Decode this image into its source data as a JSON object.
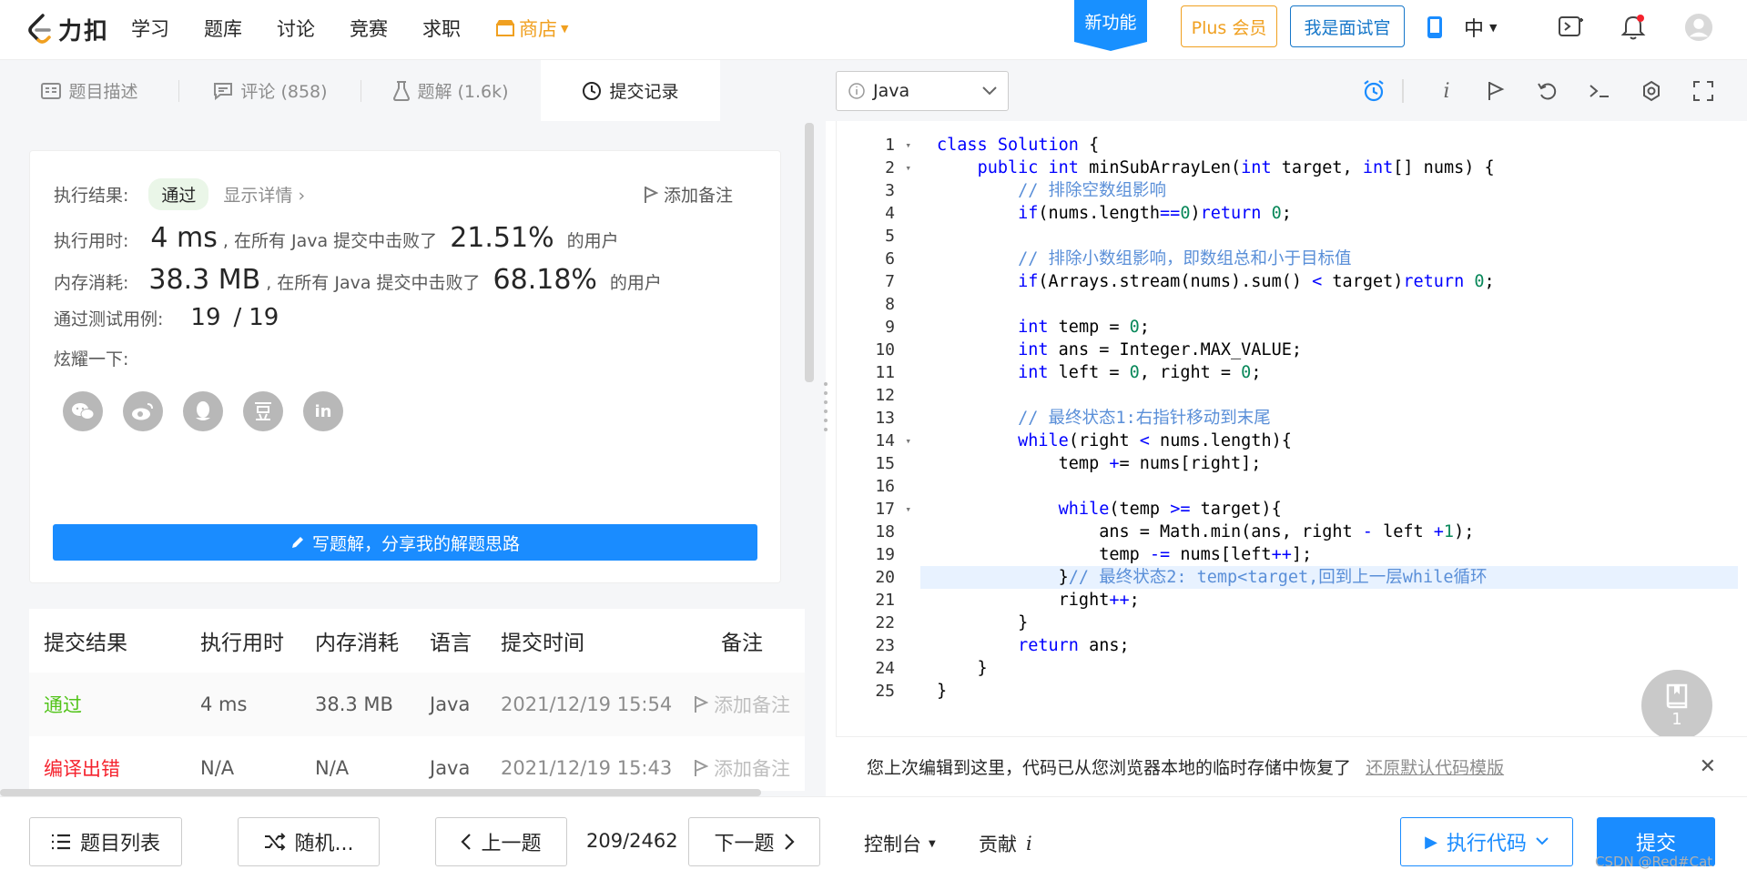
{
  "topnav": {
    "logo_text": "力扣",
    "links": [
      "学习",
      "题库",
      "讨论",
      "竞赛",
      "求职"
    ],
    "shop_label": "商店",
    "new_feature": "新功能",
    "plus_label": "Plus 会员",
    "interviewer_label": "我是面试官",
    "lang_label": "中"
  },
  "left_tabs": [
    {
      "label": "题目描述",
      "icon": "description-icon"
    },
    {
      "label": "评论 (858)",
      "icon": "comment-icon"
    },
    {
      "label": "题解 (1.6k)",
      "icon": "flask-icon"
    },
    {
      "label": "提交记录",
      "icon": "clock-icon"
    }
  ],
  "editor_toolbar": {
    "language": "Java",
    "icons": [
      "alarm-icon",
      "info-icon",
      "flag-icon",
      "reset-icon",
      "terminal-icon",
      "settings-icon",
      "fullscreen-icon"
    ]
  },
  "result": {
    "exec_result_label": "执行结果:",
    "status": "通过",
    "show_detail": "显示详情 ›",
    "add_note": "添加备注",
    "time_label": "执行用时:",
    "time_value": "4 ms",
    "time_mid": ", 在所有 Java 提交中击败了",
    "time_pct": "21.51%",
    "time_tail": "的用户",
    "mem_label": "内存消耗:",
    "mem_value": "38.3 MB",
    "mem_mid": ", 在所有 Java 提交中击败了",
    "mem_pct": "68.18%",
    "mem_tail": "的用户",
    "cases_label": "通过测试用例:",
    "cases_passed": "19",
    "cases_sep": "/",
    "cases_total": "19",
    "share_label": "炫耀一下:",
    "share_icons": [
      "wechat-icon",
      "weibo-icon",
      "qq-icon",
      "douban-icon",
      "linkedin-icon"
    ],
    "write_solution": "写题解，分享我的解题思路"
  },
  "submissions": {
    "headers": [
      "提交结果",
      "执行用时",
      "内存消耗",
      "语言",
      "提交时间",
      "备注"
    ],
    "rows": [
      {
        "status": "通过",
        "status_color": "#52c41a",
        "time": "4 ms",
        "memory": "38.3 MB",
        "lang": "Java",
        "submitted": "2021/12/19 15:54",
        "note": "添加备注"
      },
      {
        "status": "编译出错",
        "status_color": "#f5222d",
        "time": "N/A",
        "memory": "N/A",
        "lang": "Java",
        "submitted": "2021/12/19 15:43",
        "note": "添加备注"
      }
    ]
  },
  "code_lines": [
    "class Solution {",
    "    public int minSubArrayLen(int target, int[] nums) {",
    "        // 排除空数组影响",
    "        if(nums.length==0)return 0;",
    "",
    "        // 排除小数组影响，即数组总和小于目标值",
    "        if(Arrays.stream(nums).sum() < target)return 0;",
    "",
    "        int temp = 0;",
    "        int ans = Integer.MAX_VALUE;",
    "        int left = 0, right = 0;",
    "",
    "        // 最终状态1:右指针移动到末尾",
    "        while(right < nums.length){",
    "            temp += nums[right];",
    "",
    "            while(temp >= target){",
    "                ans = Math.min(ans, right - left +1);",
    "                temp -= nums[left++];",
    "            }// 最终状态2: temp<target,回到上一层while循环",
    "            right++;",
    "        }",
    "        return ans;",
    "    }",
    "}"
  ],
  "line_numbers": [
    "1",
    "2",
    "3",
    "4",
    "5",
    "6",
    "7",
    "8",
    "9",
    "10",
    "11",
    "12",
    "13",
    "14",
    "15",
    "16",
    "17",
    "18",
    "19",
    "20",
    "21",
    "22",
    "23",
    "24",
    "25"
  ],
  "float_badge": "1",
  "restore": {
    "message": "您上次编辑到这里，代码已从您浏览器本地的临时存储中恢复了",
    "link": "还原默认代码模版"
  },
  "bottom": {
    "problem_list": "题目列表",
    "random": "随机...",
    "prev": "上一题",
    "page": "209/2462",
    "next": "下一题",
    "console": "控制台",
    "contribute": "贡献",
    "run": "执行代码",
    "submit": "提交",
    "watermark": "CSDN @Red#Cat"
  },
  "colors": {
    "primary": "#1a8cff",
    "gold": "#f0a020",
    "pass": "#52c41a",
    "error": "#f5222d"
  }
}
